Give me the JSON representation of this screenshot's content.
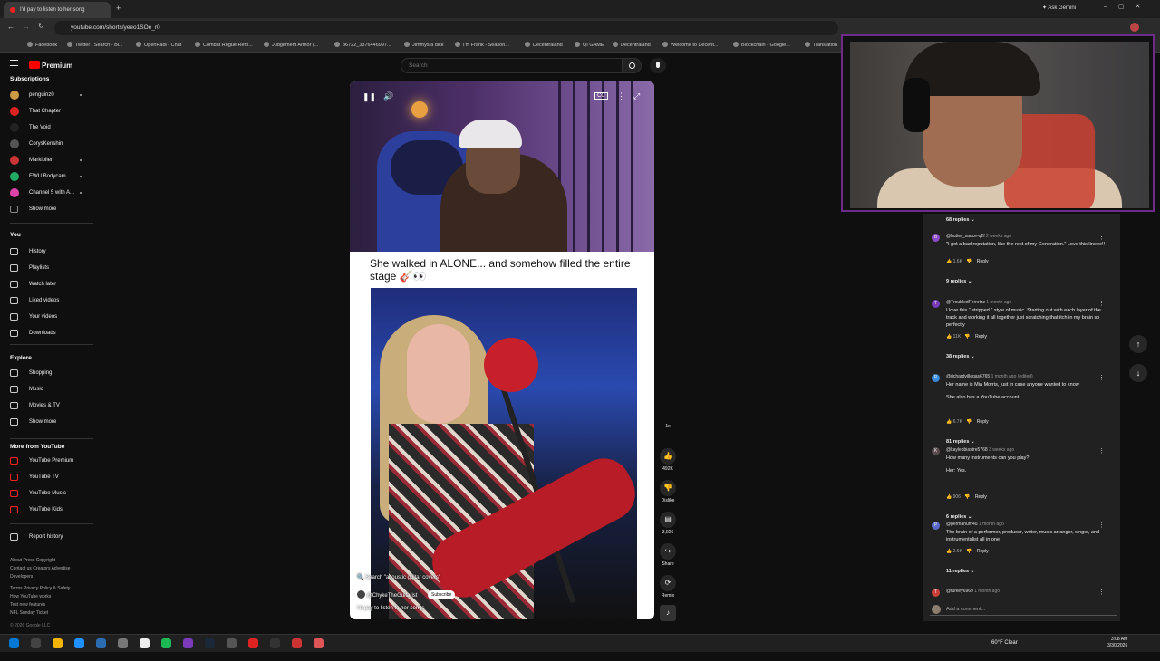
{
  "browser": {
    "tab_title": "I'd pay to listen to her song",
    "url": "youtube.com/shorts/yeeo1SOe_r0",
    "ask_gemini": "Ask Gemini",
    "bookmarks": [
      "Facebook",
      "Twitter / Search - Bi...",
      "OpenRadi - Chat",
      "Combat Rogue Refo...",
      "Judgement Armor (...",
      "86722_3376446997...",
      "Jimmys a dick",
      "I'm Frank - Season...",
      "Decentraland",
      "QI GAME",
      "Decentraland",
      "Welcome to Decent...",
      "Blockchain - Google...",
      "Translation"
    ]
  },
  "yt": {
    "logo": "Premium",
    "search_placeholder": "Search",
    "subscriptions_head": "Subscriptions",
    "subscriptions": [
      "penguinz0",
      "That Chapter",
      "The Void",
      "CorysKenshin",
      "Markiplier",
      "EWU Bodycam",
      "Channel 5 with A...",
      "Show more"
    ],
    "you_head": "You",
    "you_items": [
      "History",
      "Playlists",
      "Watch later",
      "Liked videos",
      "Your videos",
      "Downloads"
    ],
    "explore_head": "Explore",
    "explore_items": [
      "Shopping",
      "Music",
      "Movies & TV",
      "Show more"
    ],
    "more_head": "More from YouTube",
    "more_items": [
      "YouTube Premium",
      "YouTube TV",
      "YouTube Music",
      "YouTube Kids"
    ],
    "report": "Report history",
    "footer1": "About  Press  Copyright",
    "footer2": "Contact us  Creators  Advertise",
    "footer3": "Developers",
    "footer4": "Terms  Privacy  Policy & Safety",
    "footer5": "How YouTube works",
    "footer6": "Test new features",
    "footer7": "NFL Sunday Ticket",
    "copyright": "© 2026 Google LLC"
  },
  "short": {
    "caption": "She walked in ALONE... and somehow filled the entire stage 🎸👀",
    "search_tag": "Search \"acoustic guitar covers\"",
    "channel": "@ChykeTheGuitarist",
    "subscribe": "Subscribe",
    "title": "I'd pay to listen to her songs"
  },
  "actions": {
    "speed": "1x",
    "likes": "492K",
    "dislike": "Dislike",
    "comments": "3,026",
    "share": "Share",
    "remix": "Remix"
  },
  "comments": {
    "top_replies": "68 replies",
    "items": [
      {
        "author": "@butter_sauce-q2f",
        "time": "2 weeks ago",
        "text": "\"I got a bad reputation, like the rest of my Generation.\" Love this lineee!!",
        "likes": "1.6K",
        "reply": "Reply",
        "replies": "9 replies"
      },
      {
        "author": "@TroubledFerretzz",
        "time": "1 month ago",
        "text": "I love this \" stripped \" style of music.  Starting out with each layer of the track and working it all together just scratching that itch in my brain so perfectly",
        "likes": "11K",
        "reply": "Reply",
        "replies": "38 replies"
      },
      {
        "author": "@richardvillegas6765",
        "time": "1 month ago (edited)",
        "text": "Her name is Mia Morris, just in case anyone wanted to know",
        "text2": "She also has a YouTube account",
        "likes": "6.7K",
        "reply": "Reply",
        "replies": "81 replies"
      },
      {
        "author": "@kaylebbiastre5768",
        "time": "3 weeks ago",
        "text": "How many instruments can you play?",
        "text2": "Her: Yes.",
        "likes": "906",
        "reply": "Reply",
        "replies": "6 replies"
      },
      {
        "author": "@permanum4u",
        "time": "1 month ago",
        "text": "The brain of a performer, producer, writer, music arranger, singer, and instrumentalist all in one",
        "likes": "2.6K",
        "reply": "Reply",
        "replies": "11 replies"
      },
      {
        "author": "@turkey6969",
        "time": "1 month ago",
        "text": "",
        "likes": "",
        "reply": "",
        "replies": ""
      }
    ],
    "add_placeholder": "Add a comment..."
  },
  "taskbar": {
    "weather": "60°F  Clear",
    "time": "3:08 AM",
    "date": "3/30/2026"
  }
}
